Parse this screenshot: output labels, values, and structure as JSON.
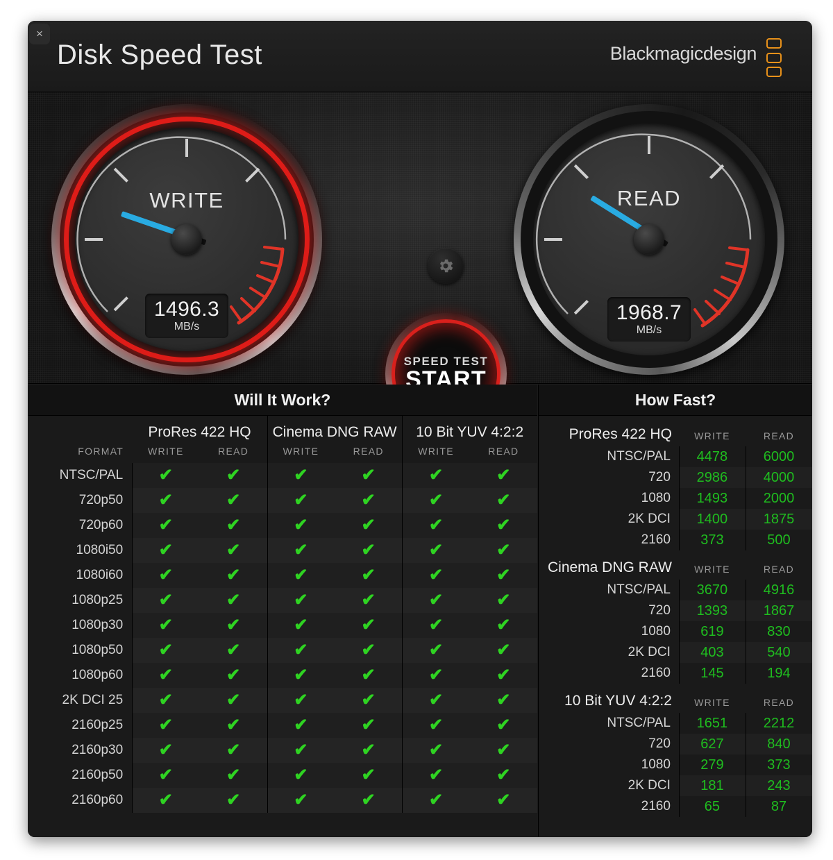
{
  "window": {
    "close_label": "×",
    "title": "Disk Speed Test",
    "brand": "Blackmagicdesign"
  },
  "colors": {
    "accent_red": "#de1c18",
    "needle_blue": "#29abe2",
    "check_green": "#2fd322",
    "value_green": "#1fbd1f",
    "brand_orange": "#e8911a"
  },
  "gauges": {
    "write": {
      "label": "WRITE",
      "value": "1496.3",
      "unit": "MB/s",
      "needle_angle_deg": 199
    },
    "read": {
      "label": "READ",
      "value": "1968.7",
      "unit": "MB/s",
      "needle_angle_deg": 212
    }
  },
  "controls": {
    "gear_icon": "gear-icon",
    "start_small": "SPEED TEST",
    "start_big": "START"
  },
  "will_it_work": {
    "heading": "Will It Work?",
    "format_header": "FORMAT",
    "groups": [
      {
        "name": "ProRes 422 HQ",
        "cols": [
          "WRITE",
          "READ"
        ]
      },
      {
        "name": "Cinema DNG RAW",
        "cols": [
          "WRITE",
          "READ"
        ]
      },
      {
        "name": "10 Bit YUV 4:2:2",
        "cols": [
          "WRITE",
          "READ"
        ]
      }
    ],
    "check_glyph": "✔",
    "rows": [
      {
        "format": "NTSC/PAL",
        "cells": [
          true,
          true,
          true,
          true,
          true,
          true
        ]
      },
      {
        "format": "720p50",
        "cells": [
          true,
          true,
          true,
          true,
          true,
          true
        ]
      },
      {
        "format": "720p60",
        "cells": [
          true,
          true,
          true,
          true,
          true,
          true
        ]
      },
      {
        "format": "1080i50",
        "cells": [
          true,
          true,
          true,
          true,
          true,
          true
        ]
      },
      {
        "format": "1080i60",
        "cells": [
          true,
          true,
          true,
          true,
          true,
          true
        ]
      },
      {
        "format": "1080p25",
        "cells": [
          true,
          true,
          true,
          true,
          true,
          true
        ]
      },
      {
        "format": "1080p30",
        "cells": [
          true,
          true,
          true,
          true,
          true,
          true
        ]
      },
      {
        "format": "1080p50",
        "cells": [
          true,
          true,
          true,
          true,
          true,
          true
        ]
      },
      {
        "format": "1080p60",
        "cells": [
          true,
          true,
          true,
          true,
          true,
          true
        ]
      },
      {
        "format": "2K DCI 25",
        "cells": [
          true,
          true,
          true,
          true,
          true,
          true
        ]
      },
      {
        "format": "2160p25",
        "cells": [
          true,
          true,
          true,
          true,
          true,
          true
        ]
      },
      {
        "format": "2160p30",
        "cells": [
          true,
          true,
          true,
          true,
          true,
          true
        ]
      },
      {
        "format": "2160p50",
        "cells": [
          true,
          true,
          true,
          true,
          true,
          true
        ]
      },
      {
        "format": "2160p60",
        "cells": [
          true,
          true,
          true,
          true,
          true,
          true
        ]
      }
    ]
  },
  "how_fast": {
    "heading": "How Fast?",
    "col_write": "WRITE",
    "col_read": "READ",
    "sections": [
      {
        "name": "ProRes 422 HQ",
        "rows": [
          {
            "label": "NTSC/PAL",
            "write": "4478",
            "read": "6000"
          },
          {
            "label": "720",
            "write": "2986",
            "read": "4000"
          },
          {
            "label": "1080",
            "write": "1493",
            "read": "2000"
          },
          {
            "label": "2K DCI",
            "write": "1400",
            "read": "1875"
          },
          {
            "label": "2160",
            "write": "373",
            "read": "500"
          }
        ]
      },
      {
        "name": "Cinema DNG RAW",
        "rows": [
          {
            "label": "NTSC/PAL",
            "write": "3670",
            "read": "4916"
          },
          {
            "label": "720",
            "write": "1393",
            "read": "1867"
          },
          {
            "label": "1080",
            "write": "619",
            "read": "830"
          },
          {
            "label": "2K DCI",
            "write": "403",
            "read": "540"
          },
          {
            "label": "2160",
            "write": "145",
            "read": "194"
          }
        ]
      },
      {
        "name": "10 Bit YUV 4:2:2",
        "rows": [
          {
            "label": "NTSC/PAL",
            "write": "1651",
            "read": "2212"
          },
          {
            "label": "720",
            "write": "627",
            "read": "840"
          },
          {
            "label": "1080",
            "write": "279",
            "read": "373"
          },
          {
            "label": "2K DCI",
            "write": "181",
            "read": "243"
          },
          {
            "label": "2160",
            "write": "65",
            "read": "87"
          }
        ]
      }
    ]
  }
}
